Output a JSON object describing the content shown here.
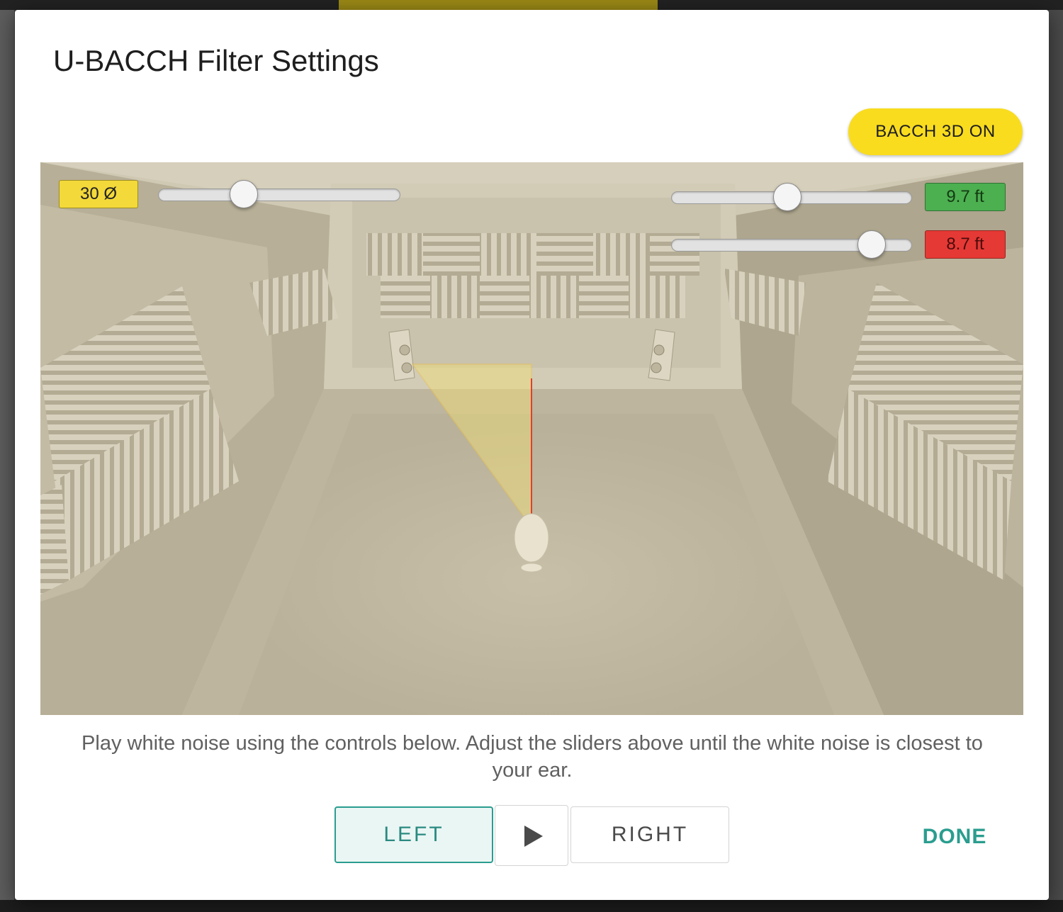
{
  "dialog": {
    "title": "U-BACCH Filter Settings",
    "toggle_label": "BACCH 3D ON"
  },
  "room": {
    "angle": {
      "label": "30 Ø",
      "value": 30,
      "slider_fraction": 0.35
    },
    "distance": {
      "label": "9.7 ft",
      "value": 9.7,
      "slider_fraction": 0.48
    },
    "offset": {
      "label": "8.7 ft",
      "value": 8.7,
      "slider_fraction": 0.83
    }
  },
  "instructions": "Play white noise using the controls below. Adjust the sliders above until the white noise is closest to your ear.",
  "controls": {
    "left_label": "LEFT",
    "play_icon": "play-icon",
    "right_label": "RIGHT",
    "done_label": "DONE"
  },
  "colors": {
    "toggle": "#f9dc1e",
    "angle_box": "#f3d93a",
    "distance_box": "#4caf50",
    "offset_box": "#e53935",
    "accent": "#2a9d8f"
  }
}
